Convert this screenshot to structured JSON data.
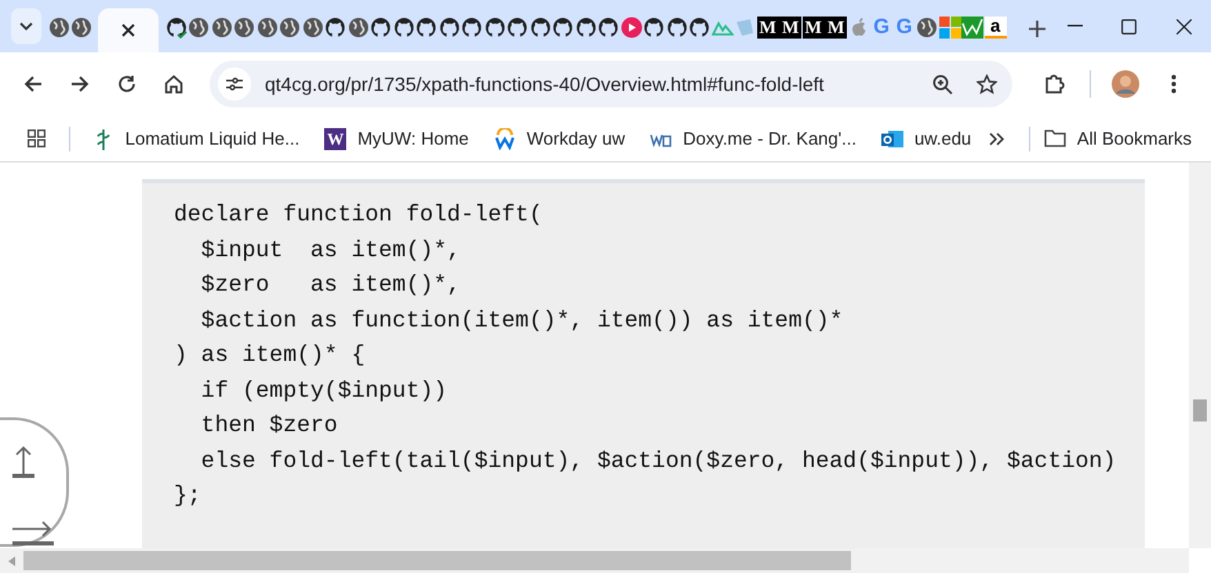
{
  "tabs": [
    {
      "kind": "globe",
      "selected": false
    },
    {
      "kind": "globe",
      "selected": false
    },
    {
      "selected": true
    },
    {
      "kind": "github-check",
      "selected": false
    },
    {
      "kind": "globe",
      "selected": false
    },
    {
      "kind": "globe",
      "selected": false
    },
    {
      "kind": "globe",
      "selected": false
    },
    {
      "kind": "globe",
      "selected": false
    },
    {
      "kind": "globe",
      "selected": false
    },
    {
      "kind": "globe",
      "selected": false
    },
    {
      "kind": "github",
      "selected": false
    },
    {
      "kind": "globe",
      "selected": false
    },
    {
      "kind": "github",
      "selected": false
    },
    {
      "kind": "github",
      "selected": false
    },
    {
      "kind": "github",
      "selected": false
    },
    {
      "kind": "github",
      "selected": false
    },
    {
      "kind": "github",
      "selected": false
    },
    {
      "kind": "github",
      "selected": false
    },
    {
      "kind": "github",
      "selected": false
    },
    {
      "kind": "github",
      "selected": false
    },
    {
      "kind": "github",
      "selected": false
    },
    {
      "kind": "github",
      "selected": false
    },
    {
      "kind": "github",
      "selected": false
    },
    {
      "kind": "red",
      "selected": false
    },
    {
      "kind": "github",
      "selected": false
    },
    {
      "kind": "github",
      "selected": false
    },
    {
      "kind": "github",
      "selected": false
    },
    {
      "kind": "mountain",
      "selected": false
    },
    {
      "kind": "paper",
      "selected": false
    },
    {
      "kind": "letter",
      "glyph": "M",
      "selected": false
    },
    {
      "kind": "letter",
      "glyph": "M",
      "selected": false
    },
    {
      "kind": "letter",
      "glyph": "M",
      "selected": false
    },
    {
      "kind": "letter",
      "glyph": "M",
      "selected": false
    },
    {
      "kind": "apple",
      "selected": false
    },
    {
      "kind": "google",
      "glyph": "G",
      "selected": false
    },
    {
      "kind": "google",
      "glyph": "G",
      "selected": false
    },
    {
      "kind": "globe",
      "selected": false
    },
    {
      "kind": "windows",
      "selected": false
    },
    {
      "kind": "chart",
      "selected": false
    },
    {
      "kind": "amazon",
      "glyph": "a",
      "selected": false
    }
  ],
  "address_bar": {
    "url": "qt4cg.org/pr/1735/xpath-functions-40/Overview.html#func-fold-left"
  },
  "bookmarks": [
    {
      "kind": "plant",
      "label": "Lomatium Liquid He..."
    },
    {
      "kind": "w-square",
      "glyph": "W",
      "label": "MyUW: Home"
    },
    {
      "kind": "workday",
      "label": "Workday uw"
    },
    {
      "kind": "doxy",
      "label": "Doxy.me - Dr. Kang'..."
    },
    {
      "kind": "outlook",
      "label": "uw.edu"
    }
  ],
  "all_bookmarks": "All Bookmarks",
  "code": [
    "declare function fold-left(",
    "  $input  as item()*,",
    "  $zero   as item()*,",
    "  $action as function(item()*, item()) as item()*",
    ") as item()* {",
    "  if (empty($input))",
    "  then $zero",
    "  else fold-left(tail($input), $action($zero, head($input)), $action)",
    "};"
  ]
}
